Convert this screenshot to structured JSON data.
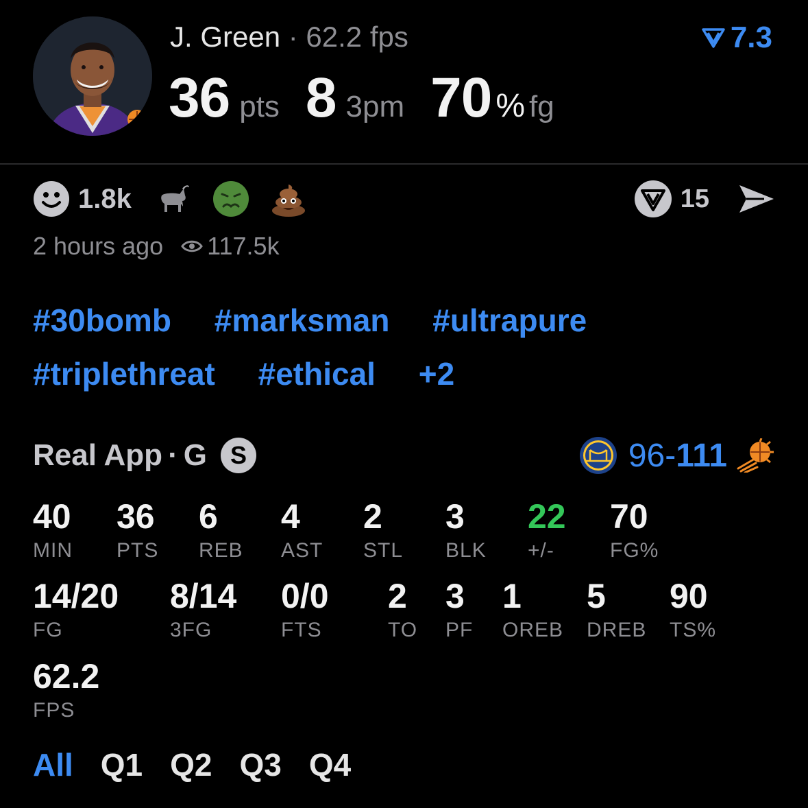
{
  "colors": {
    "accent": "#3d8bf2",
    "positive": "#34c759",
    "muted": "#8e8e93",
    "background": "#000000"
  },
  "header": {
    "player_name": "J. Green",
    "separator": "·",
    "fps_text": "62.2 fps",
    "rating": "7.3",
    "rating_icon": "real-v-icon",
    "stats": [
      {
        "value": "36",
        "unit": "pts"
      },
      {
        "value": "8",
        "unit": "3pm"
      },
      {
        "value": "70",
        "suffix": "%",
        "unit": "fg"
      }
    ]
  },
  "reactions": {
    "smile_icon": "smiley-icon",
    "smile_count": "1.8k",
    "goat_icon": "goat-icon",
    "sick_icon": "nauseated-face-icon",
    "poop_icon": "poop-icon",
    "comment_icon": "real-v-circle-icon",
    "comment_count": "15",
    "share_icon": "send-icon"
  },
  "meta": {
    "time_ago": "2 hours ago",
    "views": "117.5k",
    "views_icon": "eye-icon"
  },
  "hashtags": {
    "row1": [
      "#30bomb",
      "#marksman",
      "#ultrapure"
    ],
    "row2": [
      "#triplethreat",
      "#ethical",
      "+2"
    ]
  },
  "source": {
    "app": "Real App",
    "dot": "·",
    "position": "G",
    "badge": "S",
    "away_logo": "warriors-logo",
    "away_score": "96",
    "dash": "-",
    "home_score": "111",
    "home_logo": "suns-logo"
  },
  "stats": {
    "row1": [
      {
        "value": "40",
        "label": "MIN"
      },
      {
        "value": "36",
        "label": "PTS"
      },
      {
        "value": "6",
        "label": "REB"
      },
      {
        "value": "4",
        "label": "AST"
      },
      {
        "value": "2",
        "label": "STL"
      },
      {
        "value": "3",
        "label": "BLK"
      },
      {
        "value": "22",
        "label": "+/-"
      },
      {
        "value": "70",
        "label": "FG%"
      }
    ],
    "row2": [
      {
        "value": "14/20",
        "label": "FG"
      },
      {
        "value": "8/14",
        "label": "3FG"
      },
      {
        "value": "0/0",
        "label": "FTS"
      },
      {
        "value": "2",
        "label": "TO"
      },
      {
        "value": "3",
        "label": "PF"
      },
      {
        "value": "1",
        "label": "OREB"
      },
      {
        "value": "5",
        "label": "DREB"
      },
      {
        "value": "90",
        "label": "TS%"
      }
    ],
    "row3": [
      {
        "value": "62.2",
        "label": "FPS"
      }
    ]
  },
  "quarters": {
    "tabs": [
      "All",
      "Q1",
      "Q2",
      "Q3",
      "Q4"
    ],
    "active": "All"
  }
}
